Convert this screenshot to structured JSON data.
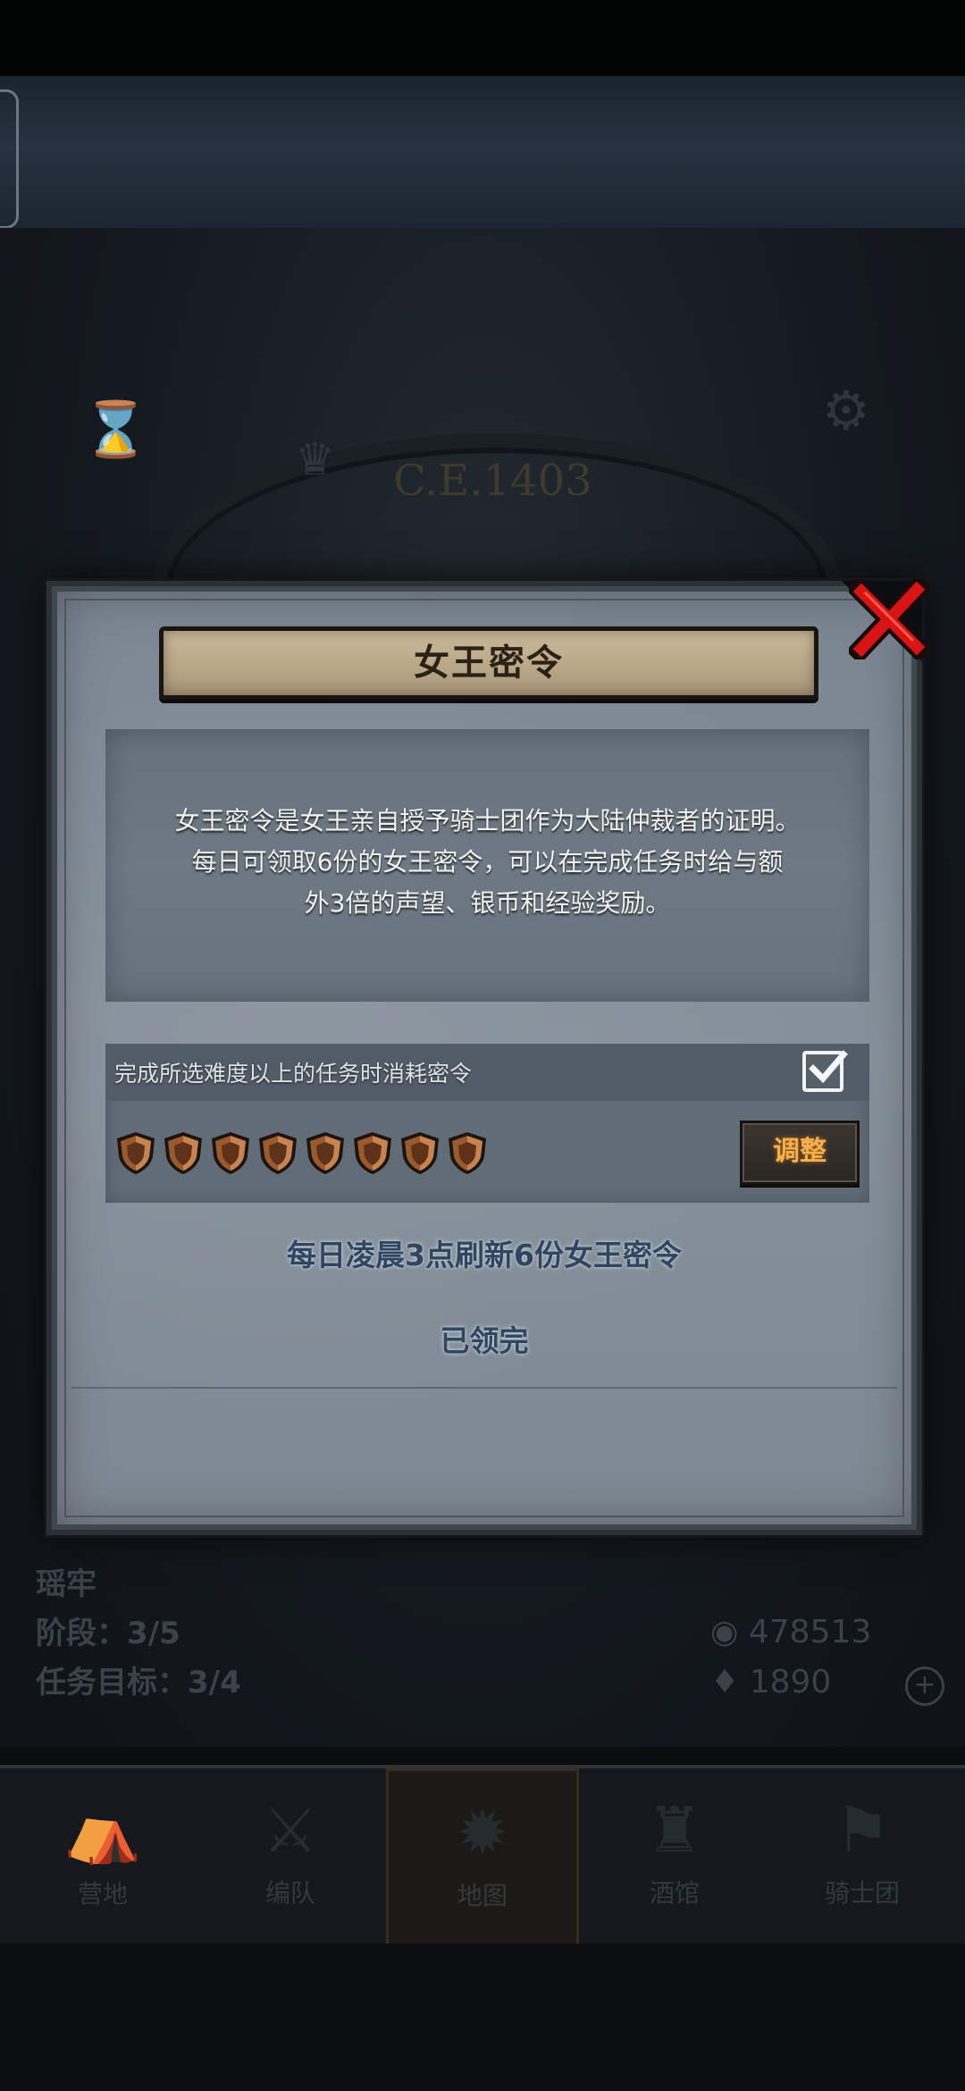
{
  "background": {
    "year": "C.E.1403",
    "info": {
      "name": "瑶牢",
      "stage": "阶段：3/5",
      "goal": "任务目标：3/4"
    },
    "resources": {
      "silver": "478513",
      "gems": "1890"
    },
    "nav": [
      {
        "label": "营地",
        "icon": "camp-icon"
      },
      {
        "label": "编队",
        "icon": "team-icon"
      },
      {
        "label": "地图",
        "icon": "map-icon"
      },
      {
        "label": "酒馆",
        "icon": "tavern-icon"
      },
      {
        "label": "骑士团",
        "icon": "order-icon"
      }
    ]
  },
  "dialog": {
    "title": "女王密令",
    "description_lines": [
      "女王密令是女王亲自授予骑士团作为大陆仲裁者的证明。",
      "每日可领取6份的女王密令，可以在完成任务时给与额",
      "外3倍的声望、银币和经验奖励。"
    ],
    "option_label": "完成所选难度以上的任务时消耗密令",
    "option_checked": true,
    "token_count": 8,
    "adjust_label": "调整",
    "refresh_text": "每日凌晨3点刷新6份女王密令",
    "status_text": "已领完"
  },
  "colors": {
    "title_plate": "#b8a786",
    "adjust_text": "#f4b050",
    "close_x": "#d91414",
    "shield": "#9a5a2e"
  }
}
